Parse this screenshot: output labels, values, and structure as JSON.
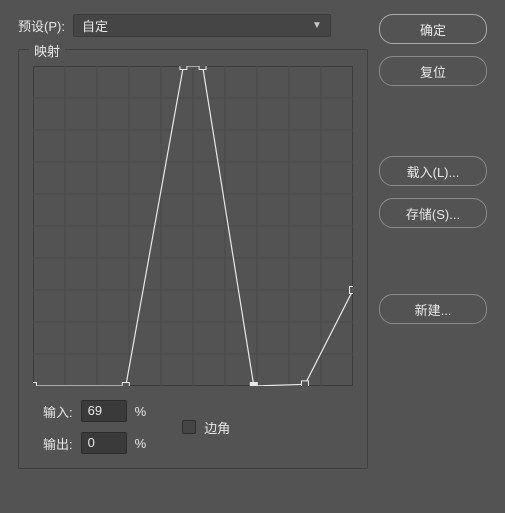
{
  "preset": {
    "label": "预设(P):",
    "value": "自定"
  },
  "group": {
    "title": "映射"
  },
  "io": {
    "input_label": "输入:",
    "input_value": "69",
    "output_label": "输出:",
    "output_value": "0",
    "percent": "%",
    "corner_label": "边角"
  },
  "buttons": {
    "ok": "确定",
    "reset": "复位",
    "load": "载入(L)...",
    "save": "存储(S)...",
    "new": "新建..."
  },
  "chart_data": {
    "type": "line",
    "title": "",
    "xlabel": "",
    "ylabel": "",
    "xlim": [
      0,
      100
    ],
    "ylim": [
      0,
      100
    ],
    "points": [
      {
        "x": 0,
        "y": 0
      },
      {
        "x": 29,
        "y": 0
      },
      {
        "x": 47,
        "y": 100
      },
      {
        "x": 53,
        "y": 100
      },
      {
        "x": 69,
        "y": 0
      },
      {
        "x": 85,
        "y": 0.5
      },
      {
        "x": 100,
        "y": 30
      }
    ],
    "selected_point_index": 4
  }
}
